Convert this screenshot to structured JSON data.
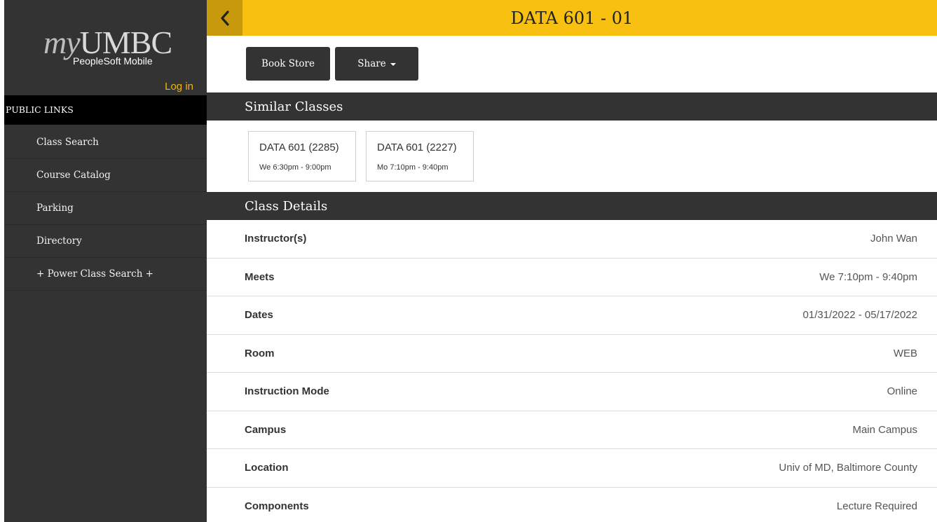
{
  "sidebar": {
    "logo_my": "my",
    "logo_text": "UMBC",
    "logo_subtitle": "PeopleSoft Mobile",
    "login_label": "Log in",
    "section_title": "PUBLIC LINKS",
    "items": [
      {
        "label": "Class Search"
      },
      {
        "label": "Course Catalog"
      },
      {
        "label": "Parking"
      },
      {
        "label": "Directory"
      },
      {
        "label": "+ Power Class Search +"
      }
    ]
  },
  "header": {
    "title": "DATA 601 - 01",
    "back_icon": "chevron-left-icon"
  },
  "actions": {
    "book_store_label": "Book Store",
    "share_label": "Share"
  },
  "similar": {
    "title": "Similar Classes",
    "cards": [
      {
        "title": "DATA 601 (2285)",
        "time": "We 6:30pm - 9:00pm"
      },
      {
        "title": "DATA 601 (2227)",
        "time": "Mo 7:10pm - 9:40pm"
      }
    ]
  },
  "details": {
    "title": "Class Details",
    "rows": [
      {
        "label": "Instructor(s)",
        "value": "John Wan"
      },
      {
        "label": "Meets",
        "value": "We 7:10pm - 9:40pm"
      },
      {
        "label": "Dates",
        "value": "01/31/2022 - 05/17/2022"
      },
      {
        "label": "Room",
        "value": "WEB"
      },
      {
        "label": "Instruction Mode",
        "value": "Online"
      },
      {
        "label": "Campus",
        "value": "Main Campus"
      },
      {
        "label": "Location",
        "value": "Univ of MD, Baltimore County"
      },
      {
        "label": "Components",
        "value": "Lecture Required"
      }
    ]
  },
  "colors": {
    "accent": "#f8c010",
    "sidebar_bg": "#333333",
    "login": "#f2b705"
  }
}
